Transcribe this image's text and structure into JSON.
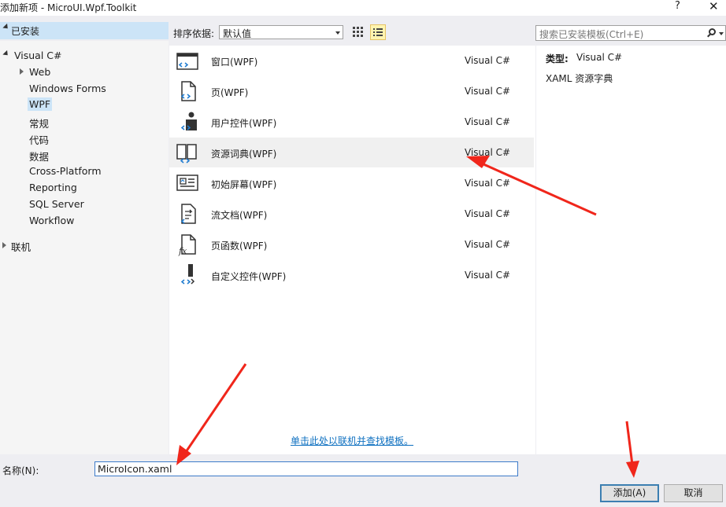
{
  "window": {
    "title": "添加新项 - MicroUI.Wpf.Toolkit",
    "help": "?",
    "close": "✕"
  },
  "left_panel": {
    "installed_label": "已安装",
    "tree": {
      "root": "Visual C#",
      "children": [
        "Web",
        "Windows Forms",
        "WPF",
        "常规",
        "代码",
        "数据",
        "Cross-Platform",
        "Reporting",
        "SQL Server",
        "Workflow"
      ],
      "selected": "WPF",
      "online": "联机"
    }
  },
  "toolbar": {
    "sort_label": "排序依据:",
    "sort_value": "默认值",
    "search_placeholder": "搜索已安装模板(Ctrl+E)"
  },
  "templates": [
    {
      "name": "窗口(WPF)",
      "lang": "Visual C#",
      "icon": "window-icon"
    },
    {
      "name": "页(WPF)",
      "lang": "Visual C#",
      "icon": "page-icon"
    },
    {
      "name": "用户控件(WPF)",
      "lang": "Visual C#",
      "icon": "user-control-icon"
    },
    {
      "name": "资源词典(WPF)",
      "lang": "Visual C#",
      "icon": "resource-dictionary-icon"
    },
    {
      "name": "初始屏幕(WPF)",
      "lang": "Visual C#",
      "icon": "splash-screen-icon"
    },
    {
      "name": "流文档(WPF)",
      "lang": "Visual C#",
      "icon": "flow-document-icon"
    },
    {
      "name": "页函数(WPF)",
      "lang": "Visual C#",
      "icon": "page-function-icon"
    },
    {
      "name": "自定义控件(WPF)",
      "lang": "Visual C#",
      "icon": "custom-control-icon"
    }
  ],
  "hovered_template": "资源词典(WPF)",
  "online_link": "单击此处以联机并查找模板。",
  "details": {
    "type_label": "类型:",
    "type_value": "Visual C#",
    "description": "XAML 资源字典"
  },
  "footer": {
    "name_label": "名称(N):",
    "name_value": "MicroIcon.xaml",
    "add_button": "添加(A)",
    "cancel_button": "取消"
  },
  "colors": {
    "selection": "#cce4f7",
    "annotation_arrow": "#f0261b",
    "link": "#0e70c0"
  }
}
